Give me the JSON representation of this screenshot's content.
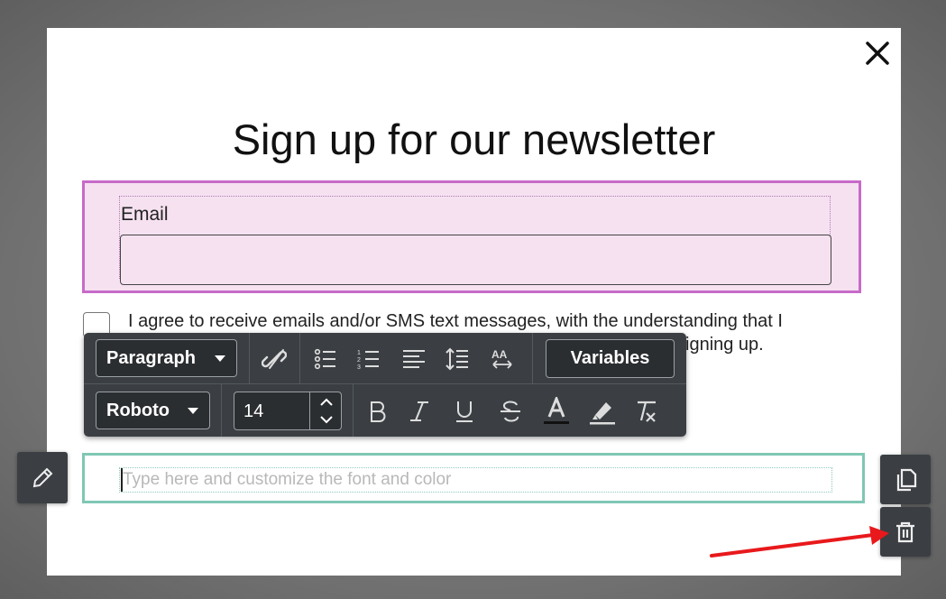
{
  "modal": {
    "title": "Sign up for our newsletter",
    "close_icon": "close-icon"
  },
  "email_field": {
    "label": "Email",
    "value": "",
    "placeholder": ""
  },
  "consent": {
    "line1": "I agree to receive emails and/or SMS text messages, with the understanding that I",
    "line2": "igning up."
  },
  "text_block": {
    "placeholder": "Type here and customize the font and color"
  },
  "toolbar": {
    "block_type": "Paragraph",
    "font": "Roboto",
    "font_size": "14",
    "variables_label": "Variables",
    "icons": [
      "unlink-icon",
      "bullet-list-icon",
      "numbered-list-icon",
      "align-left-icon",
      "line-height-icon",
      "letter-spacing-icon",
      "bold-icon",
      "italic-icon",
      "underline-icon",
      "strikethrough-icon",
      "text-color-icon",
      "highlight-icon",
      "clear-format-icon"
    ]
  },
  "side_actions": {
    "edit_icon": "pencil-icon",
    "duplicate_icon": "duplicate-icon",
    "delete_icon": "trash-icon"
  },
  "colors": {
    "email_block_bg": "#f6e1f1",
    "email_block_border": "#c76bc9",
    "text_block_border": "#7fc7b4",
    "toolbar_bg": "#3b3f43",
    "annotation_arrow": "#e8191c"
  }
}
